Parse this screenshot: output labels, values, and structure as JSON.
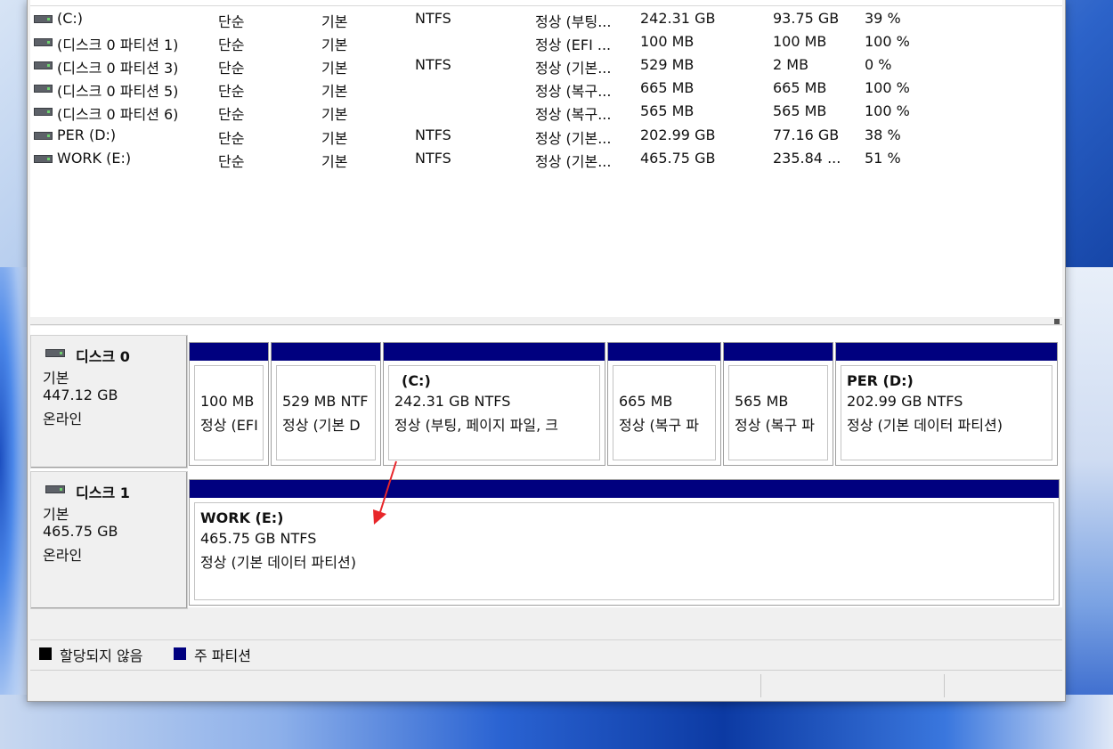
{
  "volumes": [
    {
      "name": " (C:)",
      "layout": "단순",
      "type": "기본",
      "fs": "NTFS",
      "status": "정상 (부팅...",
      "capacity": "242.31 GB",
      "free": "93.75 GB",
      "pct_free": "39 %"
    },
    {
      "name": "(디스크 0 파티션 1)",
      "layout": "단순",
      "type": "기본",
      "fs": "",
      "status": "정상 (EFI ...",
      "capacity": "100 MB",
      "free": "100 MB",
      "pct_free": "100 %"
    },
    {
      "name": "(디스크 0 파티션 3)",
      "layout": "단순",
      "type": "기본",
      "fs": "NTFS",
      "status": "정상 (기본...",
      "capacity": "529 MB",
      "free": "2 MB",
      "pct_free": "0 %"
    },
    {
      "name": "(디스크 0 파티션 5)",
      "layout": "단순",
      "type": "기본",
      "fs": "",
      "status": "정상 (복구...",
      "capacity": "665 MB",
      "free": "665 MB",
      "pct_free": "100 %"
    },
    {
      "name": "(디스크 0 파티션 6)",
      "layout": "단순",
      "type": "기본",
      "fs": "",
      "status": "정상 (복구...",
      "capacity": "565 MB",
      "free": "565 MB",
      "pct_free": "100 %"
    },
    {
      "name": "PER (D:)",
      "layout": "단순",
      "type": "기본",
      "fs": "NTFS",
      "status": "정상 (기본...",
      "capacity": "202.99 GB",
      "free": "77.16 GB",
      "pct_free": "38 %"
    },
    {
      "name": "WORK (E:)",
      "layout": "단순",
      "type": "기본",
      "fs": "NTFS",
      "status": "정상 (기본...",
      "capacity": "465.75 GB",
      "free": "235.84 ...",
      "pct_free": "51 %"
    }
  ],
  "disks": [
    {
      "title": "디스크 0",
      "type": "기본",
      "size": "447.12 GB",
      "state": "온라인",
      "partitions": [
        {
          "name": "",
          "line1": "100 MB",
          "line2": "정상 (EFI"
        },
        {
          "name": "",
          "line1": "529 MB NTF",
          "line2": "정상 (기본 D"
        },
        {
          "name": "(C:)",
          "line1": "242.31 GB NTFS",
          "line2": "정상 (부팅, 페이지 파일, 크"
        },
        {
          "name": "",
          "line1": "665 MB",
          "line2": "정상 (복구 파"
        },
        {
          "name": "",
          "line1": "565 MB",
          "line2": "정상 (복구 파"
        },
        {
          "name": "PER  (D:)",
          "line1": "202.99 GB NTFS",
          "line2": "정상 (기본 데이터 파티션)"
        }
      ]
    },
    {
      "title": "디스크 1",
      "type": "기본",
      "size": "465.75 GB",
      "state": "온라인",
      "partitions": [
        {
          "name": "WORK  (E:)",
          "line1": "465.75 GB NTFS",
          "line2": "정상 (기본 데이터 파티션)"
        }
      ]
    }
  ],
  "legend": {
    "unallocated": "할당되지 않음",
    "primary": "주 파티션"
  },
  "colors": {
    "primary": "#00007f",
    "unallocated": "#000000",
    "annotation_arrow": "#e8262a"
  }
}
